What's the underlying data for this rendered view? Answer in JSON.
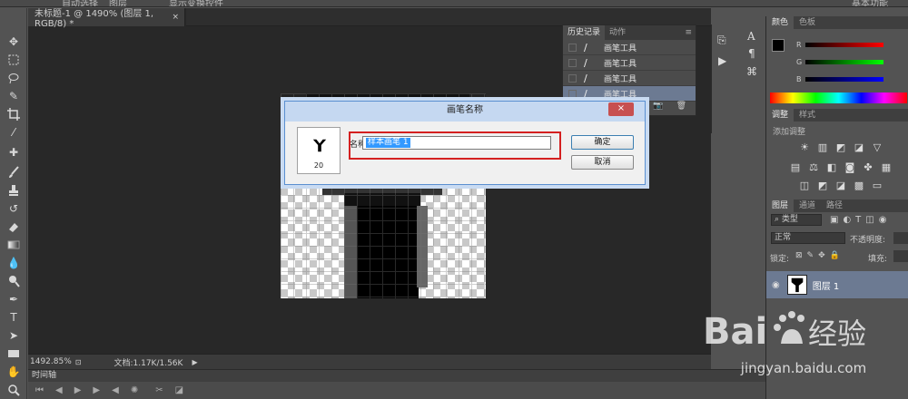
{
  "options_bar": {
    "frag1": "自动选择",
    "frag2": "图层",
    "frag3": "显示变换控件",
    "frag4": "基本功能"
  },
  "document": {
    "tab_title": "未标题-1 @ 1490% (图层 1, RGB/8) *",
    "tab_close": "×"
  },
  "status": {
    "zoom": "1492.85%",
    "doc_info": "文档:1.17K/1.56K"
  },
  "timeline": {
    "title": "时间轴"
  },
  "history": {
    "tabs": [
      "历史记录",
      "动作"
    ],
    "items": [
      "画笔工具",
      "画笔工具",
      "画笔工具",
      "画笔工具"
    ],
    "selected_index": 3
  },
  "color_panel": {
    "tabs": [
      "颜色",
      "色板"
    ],
    "r": "R",
    "g": "G",
    "b": "B"
  },
  "adjust_panel": {
    "tabs": [
      "调整",
      "样式"
    ],
    "add_label": "添加调整"
  },
  "layers_panel": {
    "tabs": [
      "图层",
      "通道",
      "路径"
    ],
    "kind": "类型",
    "blend_mode": "正常",
    "opacity_label": "不透明度:",
    "lock_label": "锁定:",
    "fill_label": "填充:",
    "layer_name": "图层 1"
  },
  "dialog": {
    "title": "画笔名称",
    "close": "×",
    "brush_size": "20",
    "name_label": "名称:",
    "name_value": "样本画笔 1",
    "ok": "确定",
    "cancel": "取消"
  },
  "watermark": {
    "text": "jingyan.baidu.com"
  },
  "colors": {
    "selection": "#6c7a92",
    "highlight": "#d42020",
    "dialog_title": "#c5d8f1"
  }
}
